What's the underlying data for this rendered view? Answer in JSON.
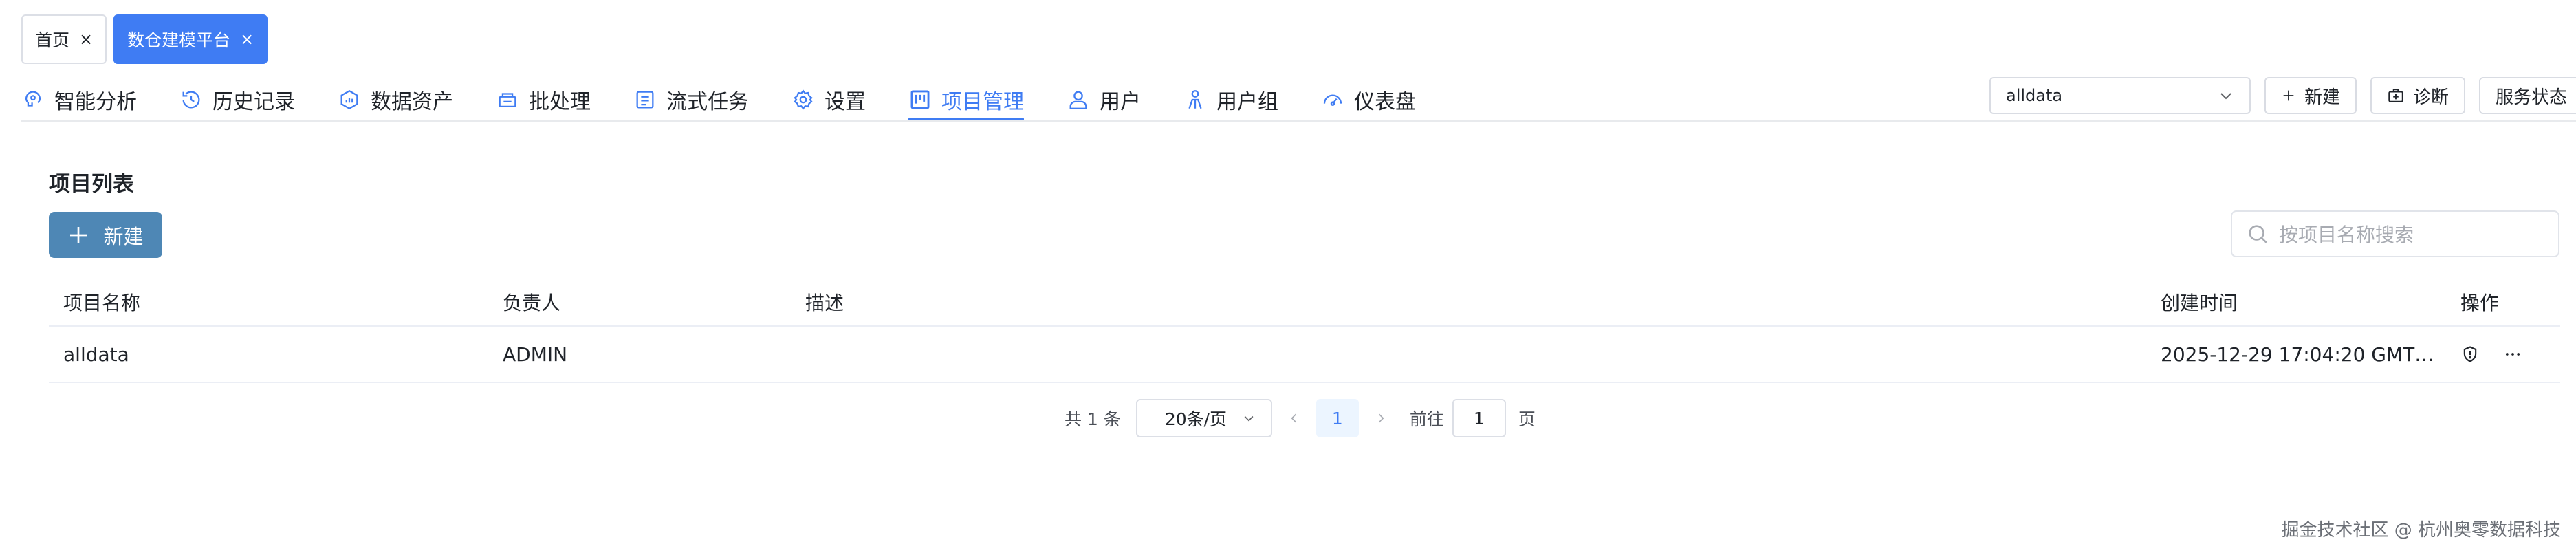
{
  "page_tabs": [
    {
      "label": "首页",
      "close": "×",
      "active": false
    },
    {
      "label": "数仓建模平台",
      "close": "×",
      "active": true
    }
  ],
  "nav": {
    "items": [
      {
        "label": "智能分析",
        "icon": "brain-icon"
      },
      {
        "label": "历史记录",
        "icon": "history-icon"
      },
      {
        "label": "数据资产",
        "icon": "asset-icon"
      },
      {
        "label": "批处理",
        "icon": "batch-icon"
      },
      {
        "label": "流式任务",
        "icon": "stream-icon"
      },
      {
        "label": "设置",
        "icon": "gear-icon"
      },
      {
        "label": "项目管理",
        "icon": "kanban-icon",
        "active": true
      },
      {
        "label": "用户",
        "icon": "user-icon"
      },
      {
        "label": "用户组",
        "icon": "user-group-icon"
      },
      {
        "label": "仪表盘",
        "icon": "dashboard-icon"
      }
    ]
  },
  "toolbar": {
    "project_select": "alldata",
    "new_label": "新建",
    "diagnose_label": "诊断",
    "service_status_label": "服务状态"
  },
  "main": {
    "title": "项目列表",
    "new_button": "新建",
    "search_placeholder": "按项目名称搜索"
  },
  "table": {
    "columns": [
      "项目名称",
      "负责人",
      "描述",
      "创建时间",
      "操作"
    ],
    "rows": [
      {
        "name": "alldata",
        "owner": "ADMIN",
        "description": "",
        "created": "2025-12-29 17:04:20 GMT…"
      }
    ]
  },
  "pagination": {
    "total": "共 1 条",
    "page_size": "20条/页",
    "current_page": "1",
    "goto_label": "前往",
    "goto_value": "1",
    "page_suffix": "页"
  },
  "watermark": "掘金技术社区 @ 杭州奥零数据科技",
  "colors": {
    "accent": "#3f7cf3",
    "new_button": "#4e87b5"
  }
}
